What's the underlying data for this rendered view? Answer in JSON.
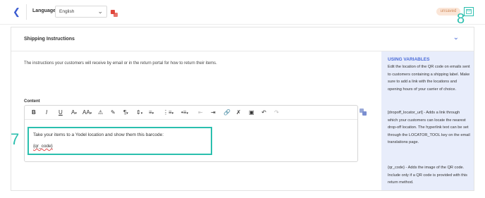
{
  "header": {
    "language_label": "Language",
    "language_value": "English",
    "status_badge": "unsaved",
    "annotation_step_save": "8"
  },
  "card": {
    "title": "Shipping Instructions",
    "description": "The instructions your customers will receive by email or in the return portal for how to return their items.",
    "content_label": "Content",
    "annotation_step_editor": "7",
    "editor": {
      "line1": "Take your items to a Yodel location and show them this barcode:",
      "line2": "{qr_code}"
    },
    "toolbar": {
      "bold": "B",
      "italic": "I",
      "underline": "U",
      "font_color": "A",
      "font_size": "AA",
      "paragraph": "¶",
      "undo": "↶",
      "redo": "↷"
    }
  },
  "help": {
    "title": "USING VARIABLES",
    "p1": "Edit the location of the QR code on emails sent to customers containing a shipping label. Make sure to add a link with the locations and opening hours of your carrier of choice.",
    "p2": "[dropoff_locator_url] - Adds a link through which your customers can locate the nearest drop-off location. The hyperlink text can be set through the LOCATOR_TOOL key on the email translations page.",
    "p3": "{qr_code} - Adds the image of the QR code. Include only if a QR code is provided with this return method."
  },
  "colors": {
    "accent": "#2bbfae",
    "brand_blue": "#4a6bd8",
    "badge_bg": "#fbe6d8",
    "help_bg": "#e8edfb"
  }
}
